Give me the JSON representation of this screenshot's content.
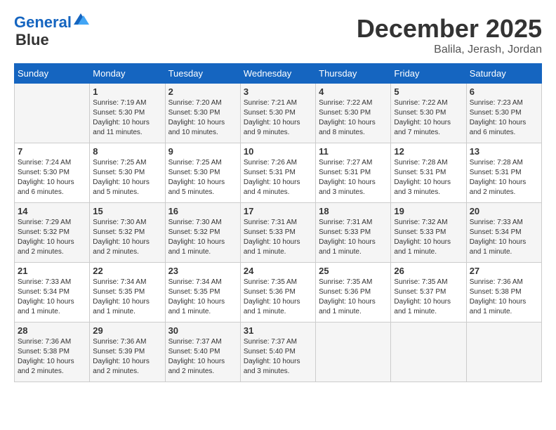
{
  "header": {
    "logo_line1": "General",
    "logo_line2": "Blue",
    "month": "December 2025",
    "location": "Balila, Jerash, Jordan"
  },
  "days_of_week": [
    "Sunday",
    "Monday",
    "Tuesday",
    "Wednesday",
    "Thursday",
    "Friday",
    "Saturday"
  ],
  "weeks": [
    [
      {
        "day": "",
        "sunrise": "",
        "sunset": "",
        "daylight": ""
      },
      {
        "day": "1",
        "sunrise": "Sunrise: 7:19 AM",
        "sunset": "Sunset: 5:30 PM",
        "daylight": "Daylight: 10 hours and 11 minutes."
      },
      {
        "day": "2",
        "sunrise": "Sunrise: 7:20 AM",
        "sunset": "Sunset: 5:30 PM",
        "daylight": "Daylight: 10 hours and 10 minutes."
      },
      {
        "day": "3",
        "sunrise": "Sunrise: 7:21 AM",
        "sunset": "Sunset: 5:30 PM",
        "daylight": "Daylight: 10 hours and 9 minutes."
      },
      {
        "day": "4",
        "sunrise": "Sunrise: 7:22 AM",
        "sunset": "Sunset: 5:30 PM",
        "daylight": "Daylight: 10 hours and 8 minutes."
      },
      {
        "day": "5",
        "sunrise": "Sunrise: 7:22 AM",
        "sunset": "Sunset: 5:30 PM",
        "daylight": "Daylight: 10 hours and 7 minutes."
      },
      {
        "day": "6",
        "sunrise": "Sunrise: 7:23 AM",
        "sunset": "Sunset: 5:30 PM",
        "daylight": "Daylight: 10 hours and 6 minutes."
      }
    ],
    [
      {
        "day": "7",
        "sunrise": "Sunrise: 7:24 AM",
        "sunset": "Sunset: 5:30 PM",
        "daylight": "Daylight: 10 hours and 6 minutes."
      },
      {
        "day": "8",
        "sunrise": "Sunrise: 7:25 AM",
        "sunset": "Sunset: 5:30 PM",
        "daylight": "Daylight: 10 hours and 5 minutes."
      },
      {
        "day": "9",
        "sunrise": "Sunrise: 7:25 AM",
        "sunset": "Sunset: 5:30 PM",
        "daylight": "Daylight: 10 hours and 5 minutes."
      },
      {
        "day": "10",
        "sunrise": "Sunrise: 7:26 AM",
        "sunset": "Sunset: 5:31 PM",
        "daylight": "Daylight: 10 hours and 4 minutes."
      },
      {
        "day": "11",
        "sunrise": "Sunrise: 7:27 AM",
        "sunset": "Sunset: 5:31 PM",
        "daylight": "Daylight: 10 hours and 3 minutes."
      },
      {
        "day": "12",
        "sunrise": "Sunrise: 7:28 AM",
        "sunset": "Sunset: 5:31 PM",
        "daylight": "Daylight: 10 hours and 3 minutes."
      },
      {
        "day": "13",
        "sunrise": "Sunrise: 7:28 AM",
        "sunset": "Sunset: 5:31 PM",
        "daylight": "Daylight: 10 hours and 2 minutes."
      }
    ],
    [
      {
        "day": "14",
        "sunrise": "Sunrise: 7:29 AM",
        "sunset": "Sunset: 5:32 PM",
        "daylight": "Daylight: 10 hours and 2 minutes."
      },
      {
        "day": "15",
        "sunrise": "Sunrise: 7:30 AM",
        "sunset": "Sunset: 5:32 PM",
        "daylight": "Daylight: 10 hours and 2 minutes."
      },
      {
        "day": "16",
        "sunrise": "Sunrise: 7:30 AM",
        "sunset": "Sunset: 5:32 PM",
        "daylight": "Daylight: 10 hours and 1 minute."
      },
      {
        "day": "17",
        "sunrise": "Sunrise: 7:31 AM",
        "sunset": "Sunset: 5:33 PM",
        "daylight": "Daylight: 10 hours and 1 minute."
      },
      {
        "day": "18",
        "sunrise": "Sunrise: 7:31 AM",
        "sunset": "Sunset: 5:33 PM",
        "daylight": "Daylight: 10 hours and 1 minute."
      },
      {
        "day": "19",
        "sunrise": "Sunrise: 7:32 AM",
        "sunset": "Sunset: 5:33 PM",
        "daylight": "Daylight: 10 hours and 1 minute."
      },
      {
        "day": "20",
        "sunrise": "Sunrise: 7:33 AM",
        "sunset": "Sunset: 5:34 PM",
        "daylight": "Daylight: 10 hours and 1 minute."
      }
    ],
    [
      {
        "day": "21",
        "sunrise": "Sunrise: 7:33 AM",
        "sunset": "Sunset: 5:34 PM",
        "daylight": "Daylight: 10 hours and 1 minute."
      },
      {
        "day": "22",
        "sunrise": "Sunrise: 7:34 AM",
        "sunset": "Sunset: 5:35 PM",
        "daylight": "Daylight: 10 hours and 1 minute."
      },
      {
        "day": "23",
        "sunrise": "Sunrise: 7:34 AM",
        "sunset": "Sunset: 5:35 PM",
        "daylight": "Daylight: 10 hours and 1 minute."
      },
      {
        "day": "24",
        "sunrise": "Sunrise: 7:35 AM",
        "sunset": "Sunset: 5:36 PM",
        "daylight": "Daylight: 10 hours and 1 minute."
      },
      {
        "day": "25",
        "sunrise": "Sunrise: 7:35 AM",
        "sunset": "Sunset: 5:36 PM",
        "daylight": "Daylight: 10 hours and 1 minute."
      },
      {
        "day": "26",
        "sunrise": "Sunrise: 7:35 AM",
        "sunset": "Sunset: 5:37 PM",
        "daylight": "Daylight: 10 hours and 1 minute."
      },
      {
        "day": "27",
        "sunrise": "Sunrise: 7:36 AM",
        "sunset": "Sunset: 5:38 PM",
        "daylight": "Daylight: 10 hours and 1 minute."
      }
    ],
    [
      {
        "day": "28",
        "sunrise": "Sunrise: 7:36 AM",
        "sunset": "Sunset: 5:38 PM",
        "daylight": "Daylight: 10 hours and 2 minutes."
      },
      {
        "day": "29",
        "sunrise": "Sunrise: 7:36 AM",
        "sunset": "Sunset: 5:39 PM",
        "daylight": "Daylight: 10 hours and 2 minutes."
      },
      {
        "day": "30",
        "sunrise": "Sunrise: 7:37 AM",
        "sunset": "Sunset: 5:40 PM",
        "daylight": "Daylight: 10 hours and 2 minutes."
      },
      {
        "day": "31",
        "sunrise": "Sunrise: 7:37 AM",
        "sunset": "Sunset: 5:40 PM",
        "daylight": "Daylight: 10 hours and 3 minutes."
      },
      {
        "day": "",
        "sunrise": "",
        "sunset": "",
        "daylight": ""
      },
      {
        "day": "",
        "sunrise": "",
        "sunset": "",
        "daylight": ""
      },
      {
        "day": "",
        "sunrise": "",
        "sunset": "",
        "daylight": ""
      }
    ]
  ]
}
